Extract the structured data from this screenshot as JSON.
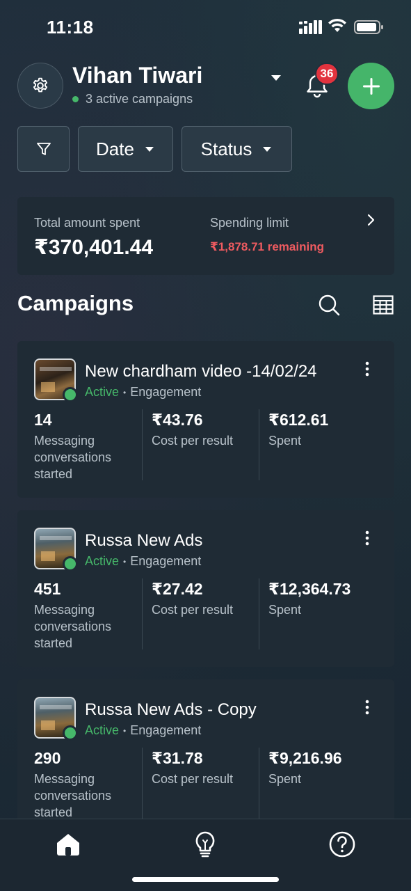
{
  "status_bar": {
    "time": "11:18"
  },
  "header": {
    "user_name": "Vihan Tiwari",
    "active_campaigns": "3 active campaigns",
    "notification_count": "36"
  },
  "filters": {
    "date_label": "Date",
    "status_label": "Status"
  },
  "summary": {
    "total_label": "Total amount spent",
    "total_value": "₹370,401.44",
    "limit_label": "Spending limit",
    "limit_remaining": "₹1,878.71 remaining"
  },
  "campaigns_section": {
    "title": "Campaigns"
  },
  "campaigns": [
    {
      "name": "New chardham video -14/02/24",
      "status": "Active",
      "objective": "Engagement",
      "results_value": "14",
      "results_label": "Messaging conversations started",
      "cpr_value": "₹43.76",
      "cpr_label": "Cost per result",
      "spent_value": "₹612.61",
      "spent_label": "Spent"
    },
    {
      "name": "Russa New Ads",
      "status": "Active",
      "objective": "Engagement",
      "results_value": "451",
      "results_label": "Messaging conversations started",
      "cpr_value": "₹27.42",
      "cpr_label": "Cost per result",
      "spent_value": "₹12,364.73",
      "spent_label": "Spent"
    },
    {
      "name": "Russa New Ads - Copy",
      "status": "Active",
      "objective": "Engagement",
      "results_value": "290",
      "results_label": "Messaging conversations started",
      "cpr_value": "₹31.78",
      "cpr_label": "Cost per result",
      "spent_value": "₹9,216.96",
      "spent_label": "Spent"
    }
  ],
  "colors": {
    "accent_green": "#45b56a",
    "badge_red": "#e2333e",
    "warning_red": "#ef5b60",
    "card_bg": "#1f2b35"
  }
}
